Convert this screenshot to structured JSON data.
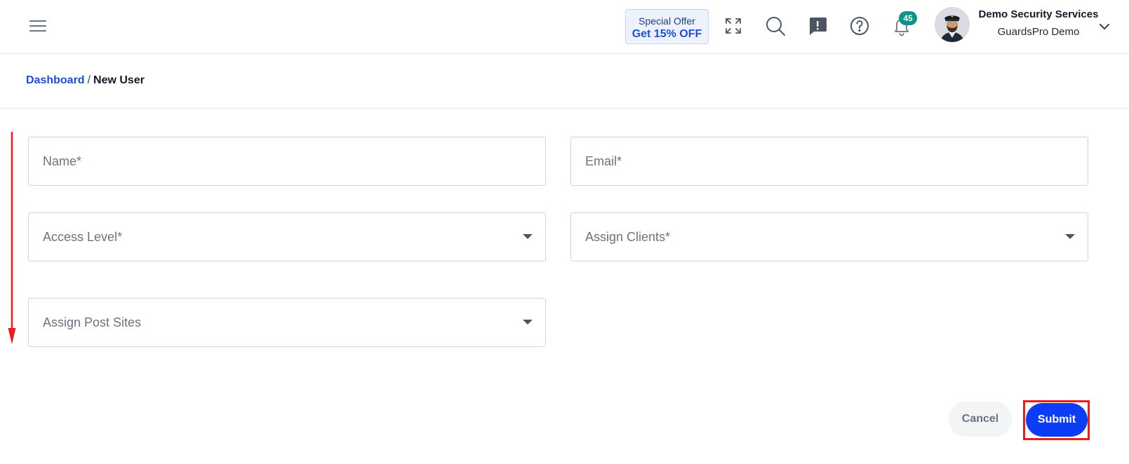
{
  "header": {
    "menu_icon": "hamburger-menu-icon",
    "offer": {
      "line1": "Special Offer",
      "line2": "Get 15% OFF"
    },
    "icons": [
      "fullscreen-icon",
      "search-icon",
      "feedback-icon",
      "help-icon",
      "bell-icon"
    ],
    "notification_count": "45",
    "user": {
      "name": "Demo Security Services",
      "org": "GuardsPro Demo"
    }
  },
  "breadcrumb": {
    "parent": "Dashboard",
    "separator": "/",
    "current": "New User"
  },
  "form": {
    "name_placeholder": "Name*",
    "email_placeholder": "Email*",
    "access_level_placeholder": "Access Level*",
    "assign_clients_placeholder": "Assign Clients*",
    "assign_post_sites_placeholder": "Assign Post Sites"
  },
  "actions": {
    "cancel_label": "Cancel",
    "submit_label": "Submit"
  },
  "colors": {
    "accent": "#0b3df5",
    "link": "#1d4ed8",
    "badge": "#0d9488",
    "annotation": "#ef1c1c"
  }
}
